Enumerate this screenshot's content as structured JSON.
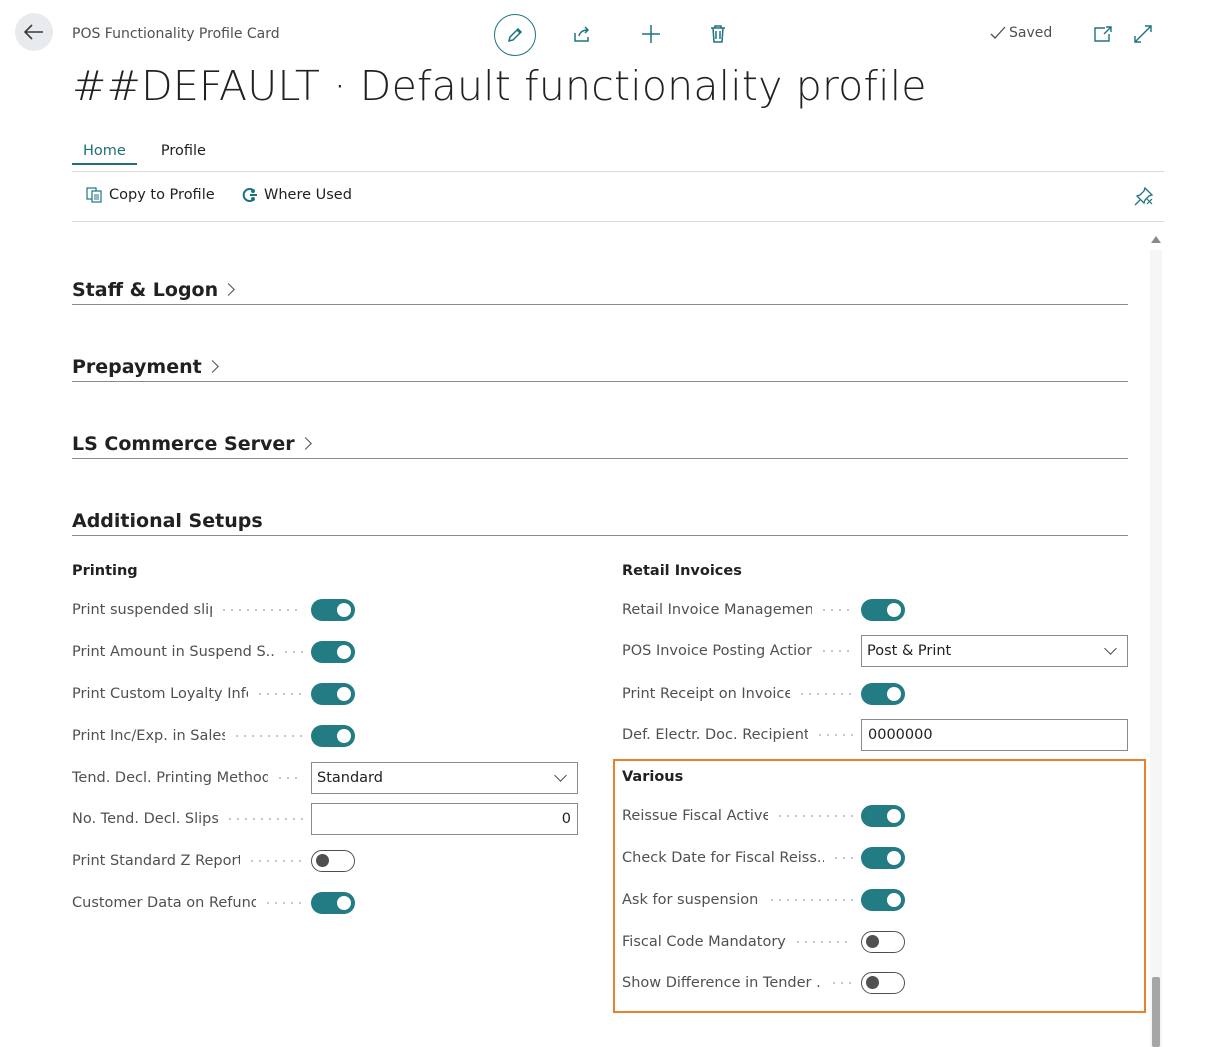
{
  "header": {
    "breadcrumb": "POS Functionality Profile Card",
    "status": "Saved",
    "title": "##DEFAULT · Default functionality profile"
  },
  "tabs": [
    {
      "label": "Home",
      "active": true
    },
    {
      "label": "Profile",
      "active": false
    }
  ],
  "actions": {
    "copy_to_profile": "Copy to Profile",
    "where_used": "Where Used"
  },
  "sections": {
    "staff_logon": "Staff & Logon",
    "prepayment": "Prepayment",
    "ls_commerce_server": "LS Commerce Server",
    "additional_setups": "Additional Setups"
  },
  "printing": {
    "title": "Printing",
    "fields": [
      {
        "label": "Print suspended slip",
        "type": "toggle",
        "on": true
      },
      {
        "label": "Print Amount in Suspend S...",
        "type": "toggle",
        "on": true
      },
      {
        "label": "Print Custom Loyalty Info",
        "type": "toggle",
        "on": true
      },
      {
        "label": "Print Inc/Exp. in Sales",
        "type": "toggle",
        "on": true
      },
      {
        "label": "Tend. Decl. Printing Method",
        "type": "select",
        "value": "Standard"
      },
      {
        "label": "No. Tend. Decl. Slips",
        "type": "number",
        "value": "0"
      },
      {
        "label": "Print Standard Z Report",
        "type": "toggle",
        "on": false
      },
      {
        "label": "Customer Data on Refund",
        "type": "toggle",
        "on": true
      }
    ]
  },
  "retail_invoices": {
    "title": "Retail Invoices",
    "fields": [
      {
        "label": "Retail Invoice Management",
        "type": "toggle",
        "on": true
      },
      {
        "label": "POS Invoice Posting Action",
        "type": "select",
        "value": "Post & Print"
      },
      {
        "label": "Print Receipt on Invoice",
        "type": "toggle",
        "on": true
      },
      {
        "label": "Def. Electr. Doc. Recipient",
        "type": "text",
        "value": "0000000"
      }
    ]
  },
  "various": {
    "title": "Various",
    "fields": [
      {
        "label": "Reissue Fiscal Active",
        "type": "toggle",
        "on": true
      },
      {
        "label": "Check Date for Fiscal Reiss...",
        "type": "toggle",
        "on": true
      },
      {
        "label": "Ask for suspension",
        "type": "toggle",
        "on": true
      },
      {
        "label": "Fiscal Code Mandatory",
        "type": "toggle",
        "on": false
      },
      {
        "label": "Show Difference in Tender ...",
        "type": "toggle",
        "on": false
      }
    ]
  },
  "colors": {
    "accent": "#237b84",
    "highlight": "#e8802e"
  }
}
